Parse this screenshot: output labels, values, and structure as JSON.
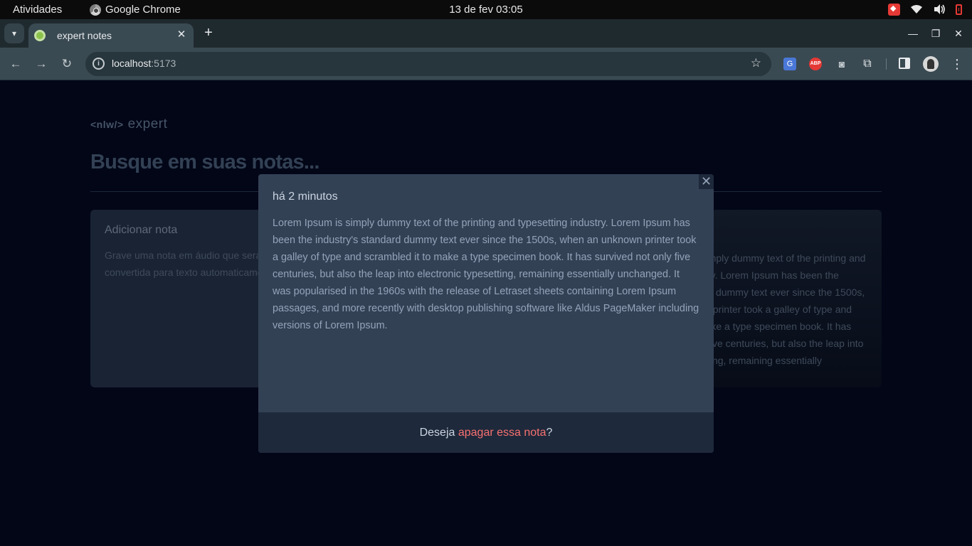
{
  "system_bar": {
    "activities": "Atividades",
    "app_name": "Google Chrome",
    "datetime": "13 de fev  03:05"
  },
  "browser": {
    "tab_title": "expert notes",
    "tab_close": "✕",
    "new_tab": "+",
    "url_host": "localhost",
    "url_port": ":5173",
    "minimize": "—",
    "maximize": "❐",
    "close": "✕",
    "icons": [
      "tab-list-icon",
      "back-icon",
      "forward-icon",
      "reload-icon",
      "info-icon",
      "star-icon",
      "translate-icon",
      "adblock-icon",
      "camera-icon",
      "extensions-icon",
      "side-panel-icon",
      "profile-avatar",
      "menu-icon"
    ]
  },
  "app": {
    "logo_brand": "<nlw/>",
    "logo_name": "expert",
    "search_placeholder": "Busque em suas notas...",
    "add_card": {
      "title": "Adicionar nota",
      "description": "Grave uma nota em áudio que será convertida para texto automaticamente."
    },
    "note_card": {
      "preview": "Lorem Ipsum is simply dummy text of the printing and typesetting industry. Lorem Ipsum has been the industry's standard dummy text ever since the 1500s, when an unknown printer took a galley of type and scrambled it to make a type specimen book. It has survived not only five centuries, but also the leap into electronic typesetting, remaining essentially unchanged."
    }
  },
  "modal": {
    "date": "há 2 minutos",
    "content": "Lorem Ipsum is simply dummy text of the printing and typesetting industry. Lorem Ipsum has been the industry's standard dummy text ever since the 1500s, when an unknown printer took a galley of type and scrambled it to make a type specimen book. It has survived not only five centuries, but also the leap into electronic typesetting, remaining essentially unchanged. It was popularised in the 1960s with the release of Letraset sheets containing Lorem Ipsum passages, and more recently with desktop publishing software like Aldus PageMaker including versions of Lorem Ipsum.",
    "close_symbol": "✕",
    "footer_prefix": "Deseja ",
    "footer_action": "apagar essa nota",
    "footer_suffix": "?"
  },
  "colors": {
    "page_bg": "#020617",
    "modal_bg": "#334155",
    "modal_footer_bg": "#1e293b",
    "danger": "#f87171"
  }
}
